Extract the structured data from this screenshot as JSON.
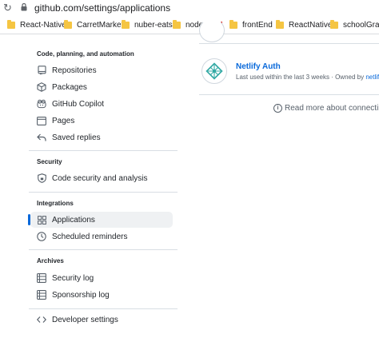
{
  "browser": {
    "url": "github.com/settings/applications",
    "bookmarks": [
      {
        "label": "React-Native",
        "icon": "folder-icon"
      },
      {
        "label": "CarretMarket",
        "icon": "folder-icon"
      },
      {
        "label": "nuber-eats",
        "icon": "folder-icon"
      },
      {
        "label": "node.js",
        "icon": "folder-icon"
      },
      {
        "label": "",
        "icon": "flag-icon"
      },
      {
        "label": "frontEnd",
        "icon": "folder-icon"
      },
      {
        "label": "ReactNative",
        "icon": "folder-icon"
      },
      {
        "label": "schoolGram",
        "icon": "folder-icon"
      }
    ]
  },
  "sidebar": {
    "sections": [
      {
        "heading": "Code, planning, and automation",
        "items": [
          {
            "label": "Repositories",
            "icon": "repo-icon"
          },
          {
            "label": "Packages",
            "icon": "package-icon"
          },
          {
            "label": "GitHub Copilot",
            "icon": "copilot-icon"
          },
          {
            "label": "Pages",
            "icon": "browser-icon"
          },
          {
            "label": "Saved replies",
            "icon": "reply-icon"
          }
        ]
      },
      {
        "heading": "Security",
        "items": [
          {
            "label": "Code security and analysis",
            "icon": "shield-lock-icon"
          }
        ]
      },
      {
        "heading": "Integrations",
        "items": [
          {
            "label": "Applications",
            "icon": "apps-icon",
            "active": true
          },
          {
            "label": "Scheduled reminders",
            "icon": "clock-icon"
          }
        ]
      },
      {
        "heading": "Archives",
        "items": [
          {
            "label": "Security log",
            "icon": "log-icon"
          },
          {
            "label": "Sponsorship log",
            "icon": "log-icon"
          }
        ]
      }
    ],
    "developer_settings": {
      "label": "Developer settings",
      "icon": "code-icon"
    }
  },
  "main": {
    "app": {
      "name": "Netlify Auth",
      "meta_prefix": "Last used within the last 3 weeks · Owned by",
      "owner": "netlify",
      "logo": "netlify-logo"
    },
    "read_more": "Read more about connecting"
  },
  "colors": {
    "accent": "#0969da",
    "active_bg": "#eff1f3",
    "netlify": "#32a9a4"
  }
}
